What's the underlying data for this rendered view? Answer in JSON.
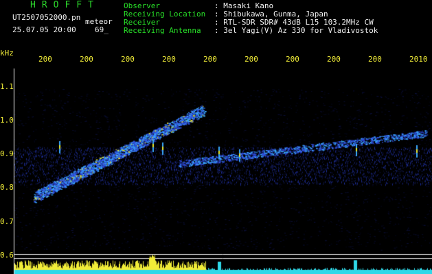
{
  "header": {
    "brand": "HROFFT",
    "filename": "UT2507052000.pn",
    "tag": "meteor",
    "datetime": "25.07.05 20:00",
    "count": "69_",
    "observer_label": "Observer",
    "observer_value": ": Masaki Kano",
    "location_label": "Receiving Location",
    "location_value": ": Shibukawa, Gunma, Japan",
    "receiver_label": "Receiver",
    "receiver_value": ": RTL-SDR SDR# 43dB L15 103.2MHz CW",
    "antenna_label": "Receiving Antenna",
    "antenna_value": ": 3el Yagi(V) Az 330 for Vladivostok"
  },
  "time_axis": {
    "ticks": [
      "200",
      "200",
      "200",
      "200",
      "200",
      "200",
      "200",
      "200",
      "200",
      "2010"
    ]
  },
  "freq_axis": {
    "unit": "kHz",
    "ticks": [
      "1.1",
      "1.0",
      "0.9",
      "0.8",
      "0.7",
      "0.6"
    ]
  },
  "colors": {
    "background": "#000000",
    "label_text": "#28e028",
    "value_text": "#f2f2f2",
    "axis_text": "#f0ec38",
    "echo_strong": "#e8e830",
    "echo_mid": "#3aa8ff",
    "noise_band": "#1a2aa8",
    "level_bar": "#f0ec38",
    "level_base": "#2fd8e8"
  },
  "chart_data": {
    "type": "heatmap",
    "title": "",
    "xlabel": "",
    "ylabel": "kHz",
    "ylim": [
      0.6,
      1.12
    ],
    "features": [
      {
        "name": "rising doppler trace",
        "x_start_min": 0.5,
        "x_end_min": 4.6,
        "y_start_khz": 0.78,
        "y_end_khz": 1.04
      },
      {
        "name": "secondary trace",
        "x_start_min": 4.0,
        "x_end_min": 10.0,
        "y_start_khz": 0.88,
        "y_end_khz": 0.97
      }
    ],
    "carrier_band_khz": [
      0.88,
      0.93
    ]
  }
}
